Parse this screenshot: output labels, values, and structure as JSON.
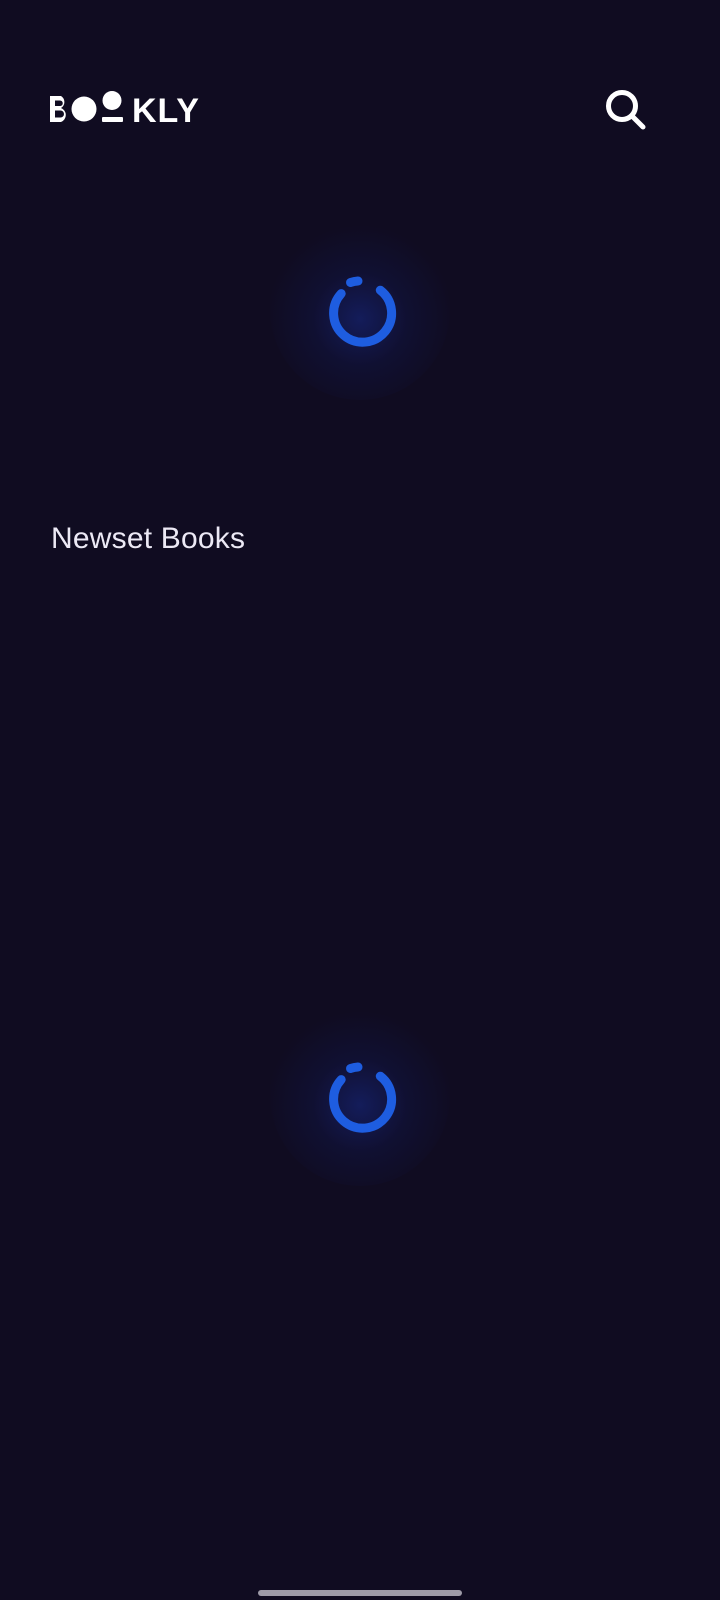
{
  "header": {
    "logo_text": "BOOKLY",
    "search_icon": "search-icon"
  },
  "sections": {
    "newest_title": "Newset Books"
  },
  "loading": {
    "spinner_icon": "loading-spinner-icon",
    "accent_color": "#1e5de0"
  },
  "theme": {
    "background": "#100c21",
    "text_color": "#ffffff"
  }
}
